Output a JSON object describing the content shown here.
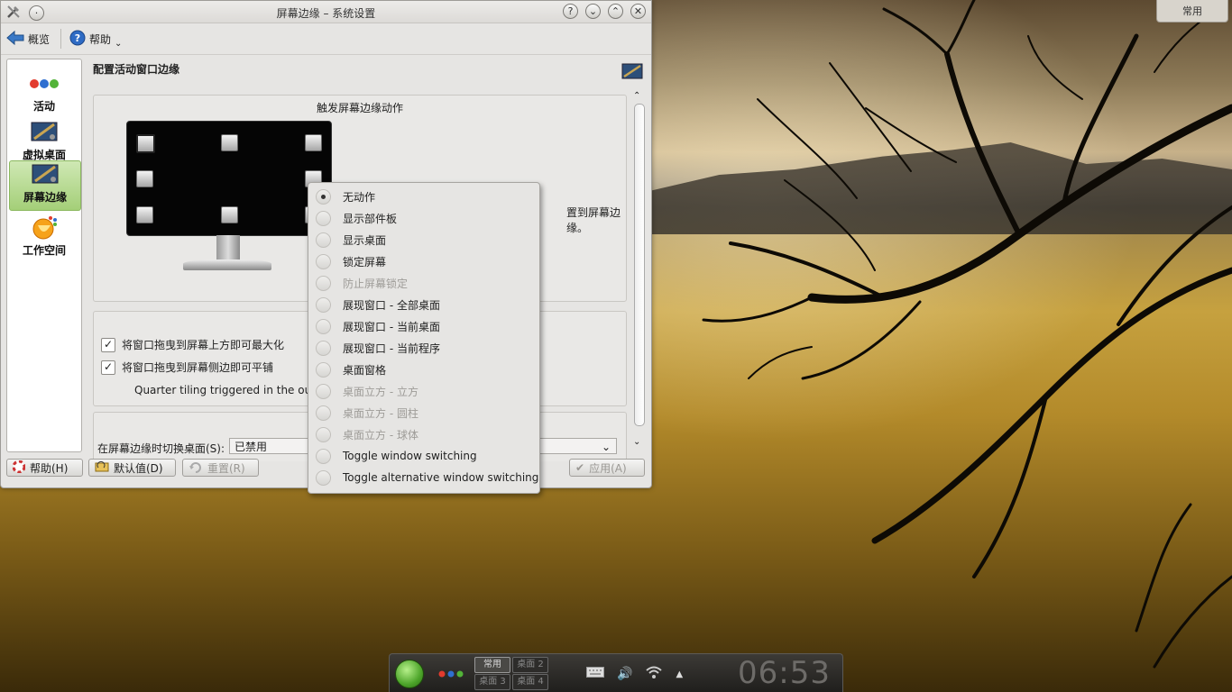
{
  "window": {
    "title": "屏幕边缘 – 系统设置"
  },
  "toolbar": {
    "overview_label": "概览",
    "help_label": "帮助",
    "help_dropdown": "⌄"
  },
  "sidebar": {
    "items": [
      {
        "label": "活动",
        "icon": "activities-icon"
      },
      {
        "label": "虚拟桌面",
        "icon": "virtual-desktop-icon"
      },
      {
        "label": "屏幕边缘",
        "icon": "screen-edges-icon",
        "active": true
      },
      {
        "label": "工作空间",
        "icon": "workspace-icon"
      }
    ]
  },
  "content": {
    "page_title": "配置活动窗口边缘",
    "trigger_group_title": "触发屏幕边缘动作",
    "edge_hint_tail": "置到屏幕边缘。",
    "window_group": {
      "maximize_label": "将窗口拖曳到屏幕上方即可最大化",
      "maximize_checked": true,
      "tile_label": "将窗口拖曳到屏幕侧边即可平铺",
      "tile_checked": true,
      "quarter_label": "Quarter tiling triggered in the outer"
    },
    "switch_desktop_label": "在屏幕边缘时切换桌面(S):",
    "switch_desktop_value": "已禁用"
  },
  "bottom_buttons": {
    "help": "帮助(H)",
    "defaults": "默认值(D)",
    "reset": "重置(R)",
    "apply": "应用(A)"
  },
  "menu": {
    "items": [
      {
        "label": "无动作",
        "checked": true,
        "disabled": false
      },
      {
        "label": "显示部件板",
        "checked": false,
        "disabled": false
      },
      {
        "label": "显示桌面",
        "checked": false,
        "disabled": false
      },
      {
        "label": "锁定屏幕",
        "checked": false,
        "disabled": false
      },
      {
        "label": "防止屏幕锁定",
        "checked": false,
        "disabled": true
      },
      {
        "label": "展现窗口 - 全部桌面",
        "checked": false,
        "disabled": false
      },
      {
        "label": "展现窗口 - 当前桌面",
        "checked": false,
        "disabled": false
      },
      {
        "label": "展现窗口 - 当前程序",
        "checked": false,
        "disabled": false
      },
      {
        "label": "桌面窗格",
        "checked": false,
        "disabled": false
      },
      {
        "label": "桌面立方 - 立方",
        "checked": false,
        "disabled": true
      },
      {
        "label": "桌面立方 - 圆柱",
        "checked": false,
        "disabled": true
      },
      {
        "label": "桌面立方 - 球体",
        "checked": false,
        "disabled": true
      },
      {
        "label": "Toggle window switching",
        "checked": false,
        "disabled": false
      },
      {
        "label": "Toggle alternative window switching",
        "checked": false,
        "disabled": false
      }
    ]
  },
  "desktop": {
    "toolbox_label": "常用"
  },
  "panel": {
    "pager": [
      "常用",
      "桌面 2",
      "桌面 3",
      "桌面 4"
    ],
    "current_desktop": "常用",
    "clock": "06:53"
  }
}
